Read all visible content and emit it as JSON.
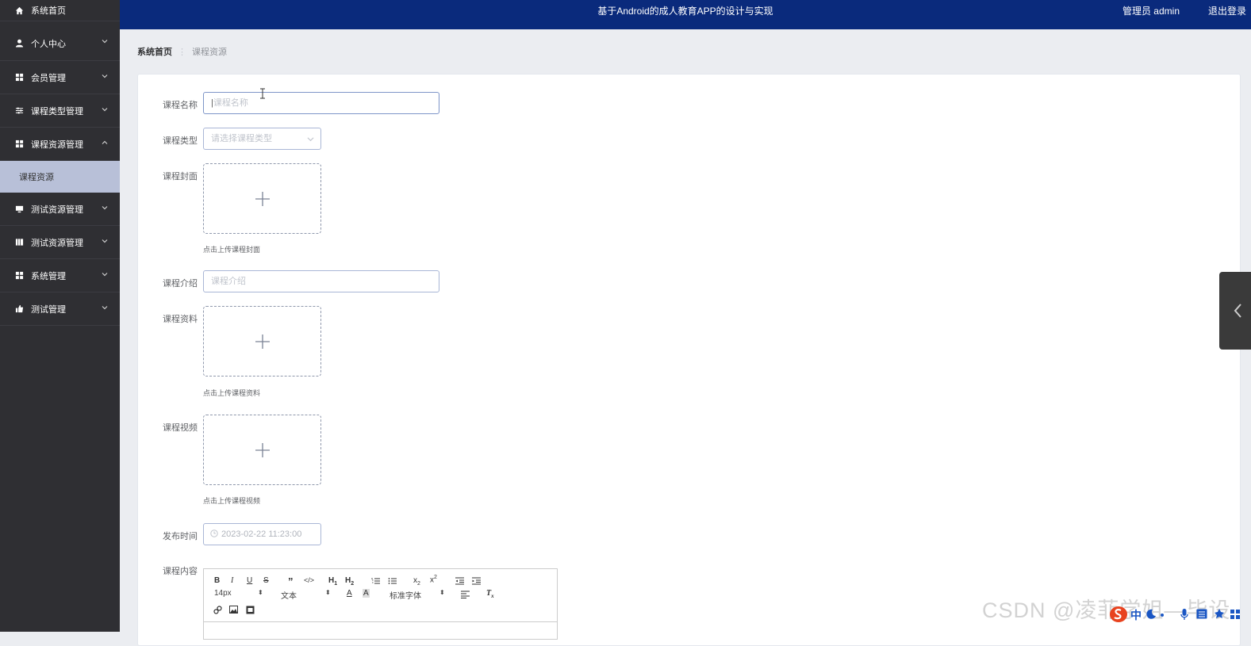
{
  "header": {
    "title": "基于Android的成人教育APP的设计与实现",
    "user": "管理员 admin",
    "logout": "退出登录"
  },
  "sidebar": {
    "items": [
      {
        "label": "系统首页"
      },
      {
        "label": "个人中心"
      },
      {
        "label": "会员管理"
      },
      {
        "label": "课程类型管理"
      },
      {
        "label": "课程资源管理"
      },
      {
        "label": "测试资源管理"
      },
      {
        "label": "测试资源管理"
      },
      {
        "label": "系统管理"
      },
      {
        "label": "测试管理"
      }
    ],
    "sub_item": "课程资源"
  },
  "breadcrumb": {
    "home": "系统首页",
    "current": "课程资源"
  },
  "form": {
    "name_label": "课程名称",
    "name_placeholder": "课程名称",
    "type_label": "课程类型",
    "type_placeholder": "请选择课程类型",
    "cover_label": "课程封面",
    "cover_hint": "点击上传课程封面",
    "intro_label": "课程介绍",
    "intro_placeholder": "课程介绍",
    "material_label": "课程资料",
    "material_hint": "点击上传课程资料",
    "video_label": "课程视频",
    "video_hint": "点击上传课程视频",
    "time_label": "发布时间",
    "time_value": "2023-02-22 11:23:00",
    "content_label": "课程内容"
  },
  "editor": {
    "font_size": "14px",
    "header_select": "文本",
    "font_family": "标准字体"
  },
  "watermark": "CSDN @凌菲学姐—毕设",
  "ime_label": "中"
}
